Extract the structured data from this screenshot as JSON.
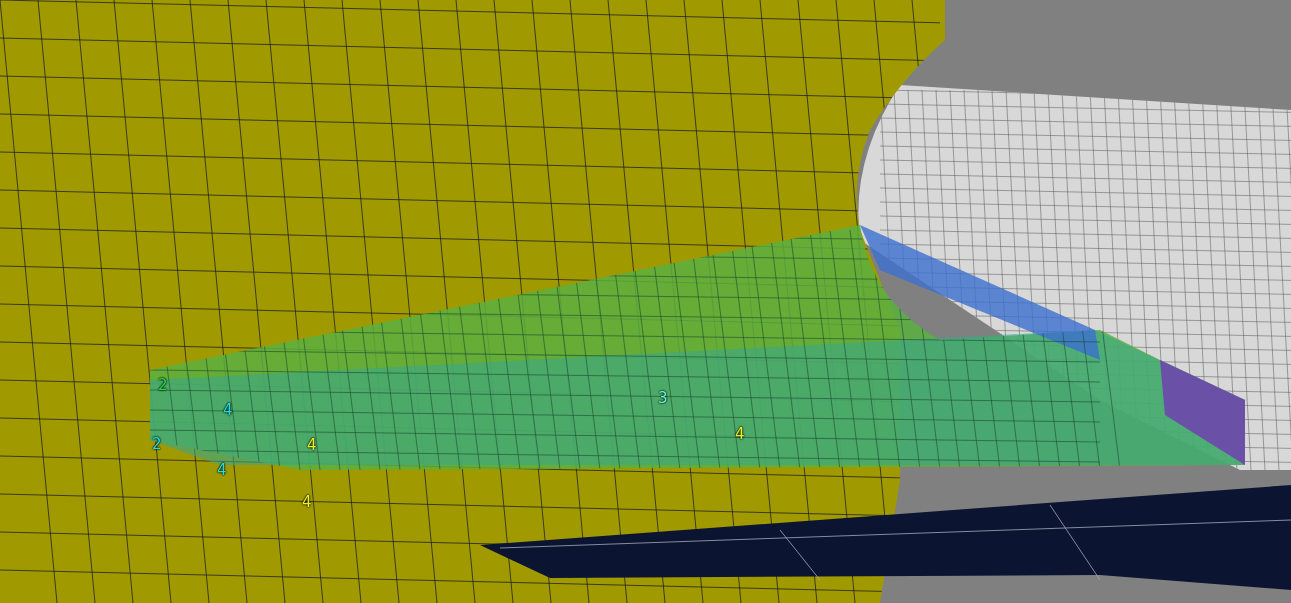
{
  "viewport": {
    "vertex_labels": [
      {
        "text": "2",
        "color": "#22dd44"
      },
      {
        "text": "4",
        "color": "#22dddd"
      },
      {
        "text": "2",
        "color": "#22dddd"
      },
      {
        "text": "4",
        "color": "#22dddd"
      },
      {
        "text": "4",
        "color": "#eeee22"
      },
      {
        "text": "4",
        "color": "#eeee22"
      },
      {
        "text": "3",
        "color": "#66ffdd"
      },
      {
        "text": "4",
        "color": "#eeee22"
      }
    ]
  }
}
